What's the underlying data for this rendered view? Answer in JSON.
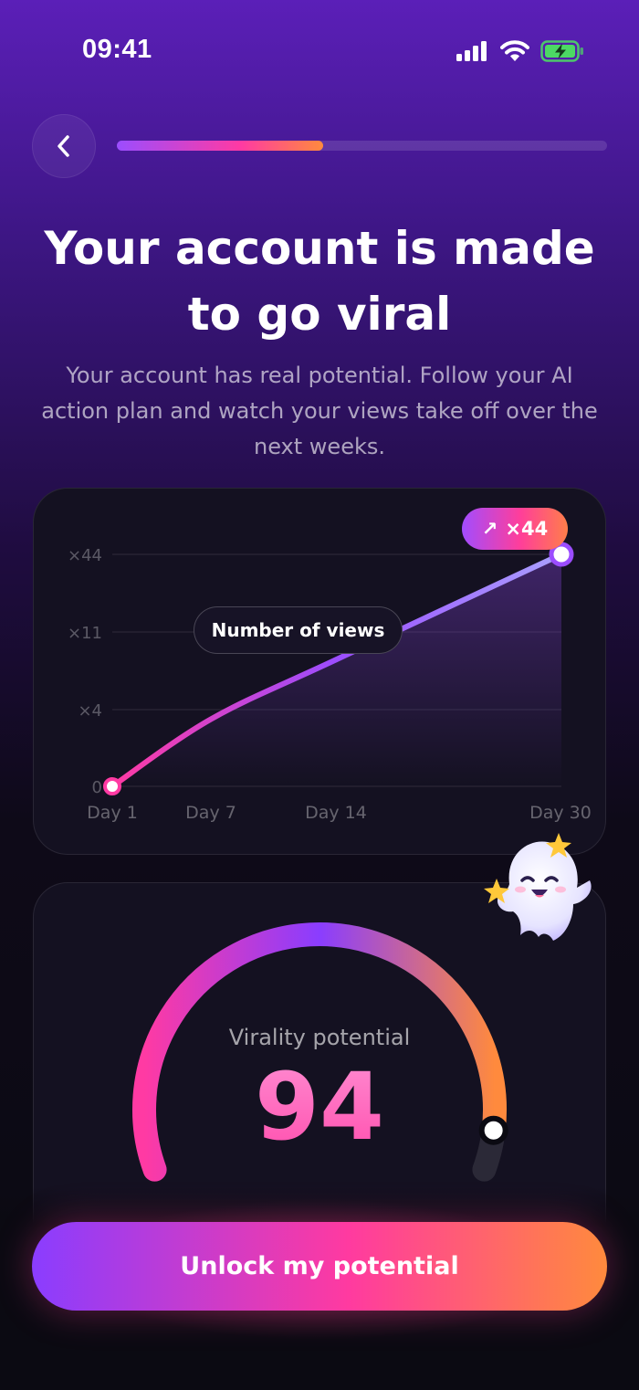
{
  "status_bar": {
    "time": "09:41"
  },
  "header": {
    "progress_value": 0.42
  },
  "title": "Your account is made to go viral",
  "subtitle": "Your account has real potential. Follow your AI action plan and watch your views take off over the next weeks.",
  "chart_data": {
    "type": "line",
    "pill_label": "Number of views",
    "badge": {
      "arrow": "↗",
      "text": "×44"
    },
    "y_ticks": [
      "×44",
      "×11",
      "×4",
      "0"
    ],
    "x_ticks": [
      "Day 1",
      "Day 7",
      "Day 14",
      "Day 30"
    ],
    "series": [
      {
        "x": [
          "Day 1",
          "Day 7",
          "Day 14",
          "Day 30"
        ],
        "y": [
          0,
          3.5,
          8.5,
          44
        ]
      }
    ],
    "colors": {
      "start": "#ff3aa3",
      "mid": "#9b4dff",
      "end": "#a9a0ff"
    }
  },
  "gauge": {
    "label": "Virality potential",
    "value": "94",
    "fraction": 0.94,
    "colors": {
      "start": "#ff3aa3",
      "mid": "#8a3dff",
      "end": "#ff8a3d"
    }
  },
  "mascot": {
    "icon": "ghost-mascot-icon"
  },
  "cta": {
    "label": "Unlock my potential"
  }
}
